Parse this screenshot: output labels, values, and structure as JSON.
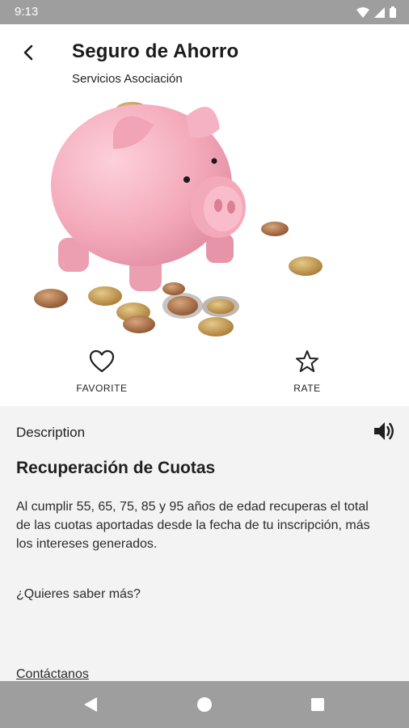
{
  "status_bar": {
    "time": "9:13"
  },
  "header": {
    "title": "Seguro de Ahorro",
    "subtitle": "Servicios Asociación"
  },
  "hero": {
    "image": "piggy-bank-with-coins"
  },
  "actions": {
    "favorite_label": "FAVORITE",
    "rate_label": "RATE"
  },
  "content": {
    "section_label": "Description",
    "title": "Recuperación de Cuotas",
    "body": "Al cumplir 55, 65, 75, 85 y 95 años de edad recuperas el total de las cuotas aportadas desde la fecha de tu inscripción, más los intereses generados.",
    "question": "¿Quieres saber más?",
    "contact_link": "Contáctanos"
  },
  "colors": {
    "status_bar": "#9e9e9e",
    "nav_bar": "#9e9e9e",
    "content_bg": "#f3f3f3",
    "piggy_pink": "#f2a5b6"
  }
}
